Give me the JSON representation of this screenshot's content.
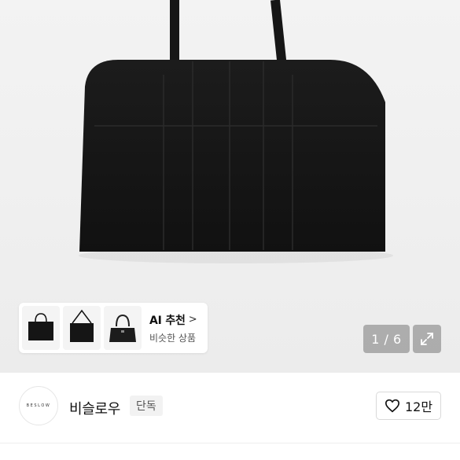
{
  "gallery": {
    "page_current": "1",
    "page_separator": "/",
    "page_total": "6",
    "page_counter_text": "1 / 6",
    "expand_icon": "expand-arrows-icon"
  },
  "ai_recommend": {
    "title": "AI 추천",
    "chevron": ">",
    "subtitle": "비슷한 상품",
    "thumbnails": [
      "black-tote-bag-thumbnail",
      "black-shoulder-bag-thumbnail",
      "black-handbag-thumbnail"
    ]
  },
  "seller": {
    "logo_text": "BESLOW",
    "name": "비슬로우",
    "badge": "단독"
  },
  "like": {
    "icon": "heart-outline-icon",
    "count": "12만"
  },
  "colors": {
    "hero_bg": "#efefef",
    "overlay": "#787878",
    "text_primary": "#111111",
    "badge_bg": "#f2f2f2"
  }
}
